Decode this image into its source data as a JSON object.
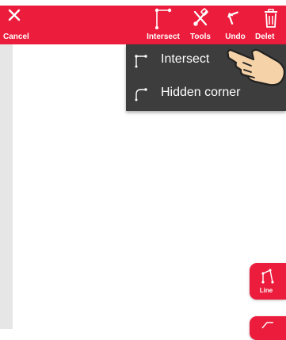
{
  "toolbar": {
    "cancel_label": "Cancel",
    "intersect_label": "Intersect",
    "tools_label": "Tools",
    "undo_label": "Undo",
    "delete_label": "Delet"
  },
  "menu": {
    "items": [
      {
        "label": "Intersect",
        "icon": "intersect-icon"
      },
      {
        "label": "Hidden corner",
        "icon": "hidden-corner-icon"
      }
    ]
  },
  "fab": {
    "line_label": "Line"
  },
  "colors": {
    "accent": "#ec1c3c",
    "menu_bg": "#3d3d3d"
  }
}
